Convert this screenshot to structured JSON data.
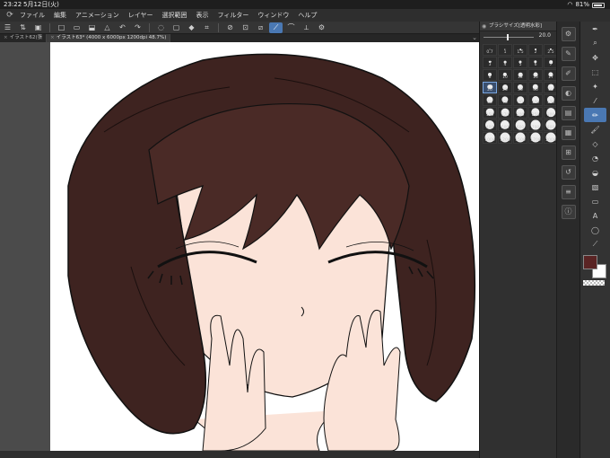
{
  "status_bar": {
    "time": "23:22",
    "date": "5月12日(火)",
    "battery": "81%"
  },
  "menu": [
    "ファイル",
    "編集",
    "アニメーション",
    "レイヤー",
    "選択範囲",
    "表示",
    "フィルター",
    "ウィンドウ",
    "ヘルプ"
  ],
  "tab": {
    "label": "イラスト63* (4000 x 6000px 1200dpi 48.7%)",
    "prev": "イラスト62(張"
  },
  "brush_panel": {
    "title": "ブラシサイズ[透明水彩]",
    "size_value": "20.0",
    "sizes": [
      "0.7",
      "1",
      "1.5",
      "2",
      "2.5",
      "3",
      "4",
      "5",
      "6",
      "7",
      "8",
      "10",
      "12",
      "15",
      "17",
      "20",
      "25",
      "30",
      "40",
      "50",
      "60",
      "70",
      "80",
      "100",
      "120",
      "150",
      "170",
      "200",
      "250",
      "300",
      "400",
      "500",
      "600",
      "700",
      "800",
      "1000",
      "1200",
      "1500",
      "1700",
      "2000"
    ],
    "selected_size": "20"
  },
  "colors": {
    "main": "#5a2424",
    "sub": "#ffffff",
    "accent": "#4a78b3"
  },
  "toolbar_icons": [
    "menu-icon",
    "undo-history-icon",
    "file-icon",
    "new-icon",
    "open-icon",
    "save-icon",
    "triangle-icon",
    "undo-icon",
    "redo-icon",
    "lasso-icon",
    "clear-icon",
    "fill-icon",
    "crop-icon",
    "transform-icon",
    "pen-pressure-icon",
    "brush-icon",
    "stroke-icon",
    "ruler-icon",
    "settings-icon"
  ]
}
